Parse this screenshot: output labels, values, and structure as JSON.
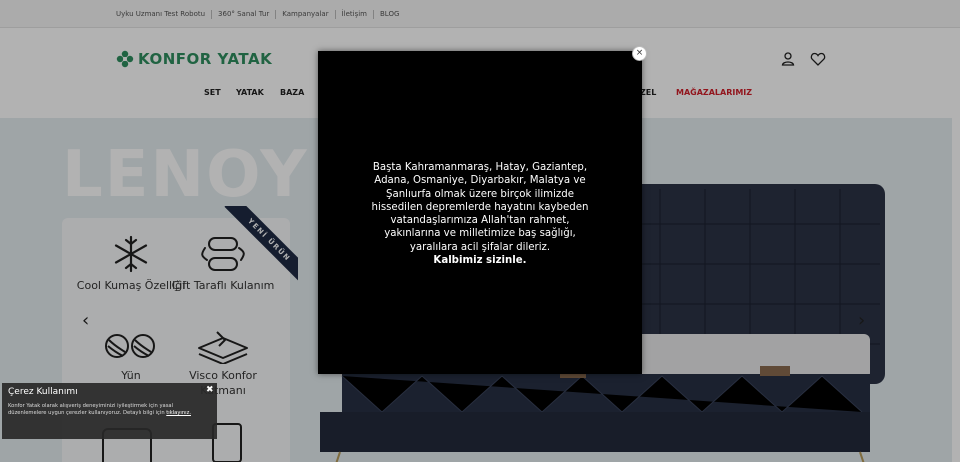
{
  "topbar": {
    "links": [
      "Uyku Uzmanı Test Robotu",
      "360° Sanal Tur",
      "Kampanyalar",
      "İletişim",
      "BLOG"
    ]
  },
  "header": {
    "logo_text": "KONFOR YATAK",
    "brand_color": "#2f8f5f",
    "icons": [
      "user-icon",
      "heart-icon"
    ]
  },
  "nav": {
    "items": [
      "SET",
      "YATAK",
      "BAZA",
      "ZEL",
      "MAĞAZALARIMIZ"
    ],
    "highlight_color": "#d11f2a"
  },
  "hero": {
    "title": "LENOY S",
    "badge": "YENİ ÜRÜN",
    "features": [
      "Cool Kumaş Özelliği",
      "Çift Taraflı Kulanım",
      "Yün",
      "Visco Konfor Katmanı"
    ],
    "prev_arrow": "‹",
    "next_arrow": "›"
  },
  "modal": {
    "lines": [
      "Başta Kahramanmaraş, Hatay, Gaziantep,",
      "Adana, Osmaniye, Diyarbakır, Malatya ve",
      "Şanlıurfa olmak üzere birçok ilimizde",
      "hissedilen depremlerde hayatını kaybeden",
      "vatandaşlarımıza Allah'tan rahmet,",
      "yakınlarına ve milletimize baş sağlığı,",
      "yaralılara acil şifalar dileriz."
    ],
    "bold_line": "Kalbimiz sizinle.",
    "close_label": "×"
  },
  "cookie": {
    "title": "Çerez Kullanımı",
    "text": "Konfor Yatak olarak alışveriş deneyiminizi iyileştirmek için yasal düzenlemelere uygun çerezler kullanıyoruz. Detaylı bilgi için",
    "link": "tıklayınız.",
    "close_label": "✖"
  }
}
